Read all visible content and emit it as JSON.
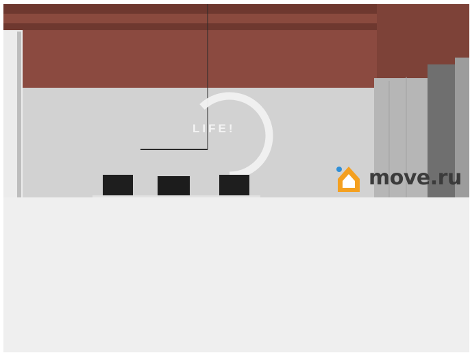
{
  "photo": {
    "watermark_life": "LIFE!",
    "watermark_brand": "move.ru",
    "icons": [
      "house-logo-icon",
      "ring-logo-icon"
    ],
    "colors": {
      "ceiling": "#7a3f35",
      "wall_upper": "#8b4a3f",
      "wall_lower": "#d3d3d3",
      "cabinet": "#b8b8b8",
      "logo_orange": "#f4a020",
      "logo_blue": "#2f8fd8",
      "brand_text": "#3b3b3b"
    }
  }
}
